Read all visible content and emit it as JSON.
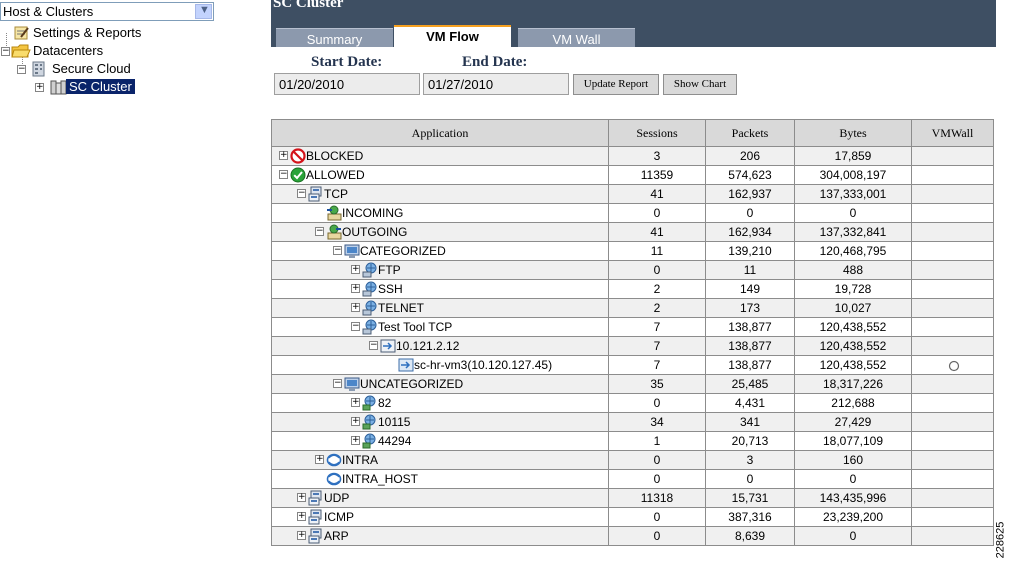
{
  "nav": {
    "view_selector": "Host & Clusters",
    "tree": [
      {
        "label": "Settings & Reports",
        "icon": "settings-reports-icon"
      },
      {
        "label": "Datacenters",
        "icon": "folder-icon"
      },
      {
        "label": "Secure Cloud",
        "icon": "datacenter-icon"
      },
      {
        "label": "SC Cluster",
        "icon": "cluster-icon",
        "selected": true
      }
    ]
  },
  "header": {
    "title": "SC Cluster",
    "tabs": [
      {
        "label": "Summary",
        "active": false
      },
      {
        "label": "VM Flow",
        "active": true
      },
      {
        "label": "VM Wall",
        "active": false
      }
    ]
  },
  "report": {
    "start_label": "Start Date:",
    "start_value": "01/20/2010",
    "end_label": "End Date:",
    "end_value": "01/27/2010",
    "update_button": "Update Report",
    "chart_button": "Show Chart"
  },
  "table": {
    "columns": [
      "Application",
      "Sessions",
      "Packets",
      "Bytes",
      "VMWall"
    ],
    "rows": [
      {
        "label": "BLOCKED",
        "level": 0,
        "expander": "+",
        "icon": "blocked-icon",
        "sessions": "3",
        "packets": "206",
        "bytes": "17,859"
      },
      {
        "label": "ALLOWED",
        "level": 0,
        "expander": "-",
        "icon": "allowed-icon",
        "sessions": "11359",
        "packets": "574,623",
        "bytes": "304,008,197"
      },
      {
        "label": "TCP",
        "level": 1,
        "expander": "-",
        "icon": "protocol-icon",
        "sessions": "41",
        "packets": "162,937",
        "bytes": "137,333,001"
      },
      {
        "label": "INCOMING",
        "level": 2,
        "expander": "",
        "icon": "incoming-icon",
        "sessions": "0",
        "packets": "0",
        "bytes": "0"
      },
      {
        "label": "OUTGOING",
        "level": 2,
        "expander": "-",
        "icon": "outgoing-icon",
        "sessions": "41",
        "packets": "162,934",
        "bytes": "137,332,841"
      },
      {
        "label": "CATEGORIZED",
        "level": 3,
        "expander": "-",
        "icon": "categorized-icon",
        "sessions": "11",
        "packets": "139,210",
        "bytes": "120,468,795"
      },
      {
        "label": "FTP",
        "level": 4,
        "expander": "+",
        "icon": "service-icon",
        "sessions": "0",
        "packets": "11",
        "bytes": "488"
      },
      {
        "label": "SSH",
        "level": 4,
        "expander": "+",
        "icon": "service-icon",
        "sessions": "2",
        "packets": "149",
        "bytes": "19,728"
      },
      {
        "label": "TELNET",
        "level": 4,
        "expander": "+",
        "icon": "service-icon",
        "sessions": "2",
        "packets": "173",
        "bytes": "10,027"
      },
      {
        "label": "Test Tool TCP",
        "level": 4,
        "expander": "-",
        "icon": "service-icon",
        "sessions": "7",
        "packets": "138,877",
        "bytes": "120,438,552"
      },
      {
        "label": "10.121.2.12",
        "level": 5,
        "expander": "-",
        "icon": "host-icon",
        "sessions": "7",
        "packets": "138,877",
        "bytes": "120,438,552"
      },
      {
        "label": "sc-hr-vm3(10.120.127.45)",
        "level": 6,
        "expander": "",
        "icon": "vm-icon",
        "sessions": "7",
        "packets": "138,877",
        "bytes": "120,438,552",
        "vmwall": true
      },
      {
        "label": "UNCATEGORIZED",
        "level": 3,
        "expander": "-",
        "icon": "categorized-icon",
        "sessions": "35",
        "packets": "25,485",
        "bytes": "18,317,226"
      },
      {
        "label": "82",
        "level": 4,
        "expander": "+",
        "icon": "unknown-service-icon",
        "sessions": "0",
        "packets": "4,431",
        "bytes": "212,688"
      },
      {
        "label": "10115",
        "level": 4,
        "expander": "+",
        "icon": "unknown-service-icon",
        "sessions": "34",
        "packets": "341",
        "bytes": "27,429"
      },
      {
        "label": "44294",
        "level": 4,
        "expander": "+",
        "icon": "unknown-service-icon",
        "sessions": "1",
        "packets": "20,713",
        "bytes": "18,077,109"
      },
      {
        "label": "INTRA",
        "level": 2,
        "expander": "+",
        "icon": "intra-icon",
        "sessions": "0",
        "packets": "3",
        "bytes": "160"
      },
      {
        "label": "INTRA_HOST",
        "level": 2,
        "expander": "",
        "icon": "intra-icon",
        "sessions": "0",
        "packets": "0",
        "bytes": "0"
      },
      {
        "label": "UDP",
        "level": 1,
        "expander": "+",
        "icon": "protocol-icon",
        "sessions": "11318",
        "packets": "15,731",
        "bytes": "143,435,996"
      },
      {
        "label": "ICMP",
        "level": 1,
        "expander": "+",
        "icon": "protocol-icon",
        "sessions": "0",
        "packets": "387,316",
        "bytes": "23,239,200"
      },
      {
        "label": "ARP",
        "level": 1,
        "expander": "+",
        "icon": "protocol-icon",
        "sessions": "0",
        "packets": "8,639",
        "bytes": "0"
      }
    ]
  },
  "figure_number": "228625"
}
